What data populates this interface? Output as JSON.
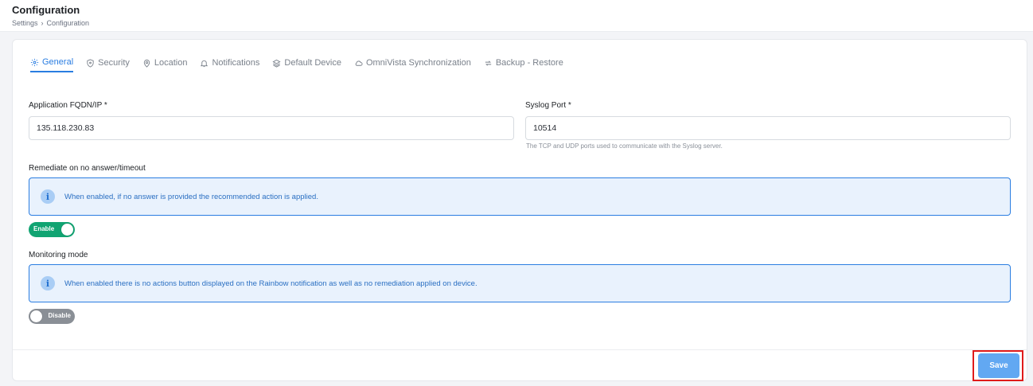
{
  "header": {
    "title": "Configuration",
    "breadcrumb": [
      "Settings",
      "Configuration"
    ],
    "breadcrumb_separator": "›"
  },
  "tabs": [
    {
      "label": "General",
      "icon": "gear-icon",
      "active": true
    },
    {
      "label": "Security",
      "icon": "shield-icon",
      "active": false
    },
    {
      "label": "Location",
      "icon": "map-pin-icon",
      "active": false
    },
    {
      "label": "Notifications",
      "icon": "bell-icon",
      "active": false
    },
    {
      "label": "Default Device",
      "icon": "layers-icon",
      "active": false
    },
    {
      "label": "OmniVista Synchronization",
      "icon": "cloud-icon",
      "active": false
    },
    {
      "label": "Backup - Restore",
      "icon": "refresh-icon",
      "active": false
    }
  ],
  "form": {
    "fqdn": {
      "label": "Application FQDN/IP *",
      "value": "135.118.230.83"
    },
    "syslog": {
      "label": "Syslog Port *",
      "value": "10514",
      "help": "The TCP and UDP ports used to communicate with the Syslog server."
    },
    "remediate": {
      "label": "Remediate on no answer/timeout",
      "info": "When enabled, if no answer is provided the recommended action is applied.",
      "toggle_label": "Enable",
      "enabled": true
    },
    "monitoring": {
      "label": "Monitoring mode",
      "info": "When enabled there is no actions button displayed on the Rainbow notification as well as no remediation applied on device.",
      "toggle_label": "Disable",
      "enabled": false
    }
  },
  "footer": {
    "save_label": "Save"
  },
  "colors": {
    "accent": "#2a7de1",
    "toggle_on": "#11a472",
    "toggle_off": "#8a8f96",
    "save_button": "#62a8f2",
    "highlight": "#e01b1b"
  }
}
